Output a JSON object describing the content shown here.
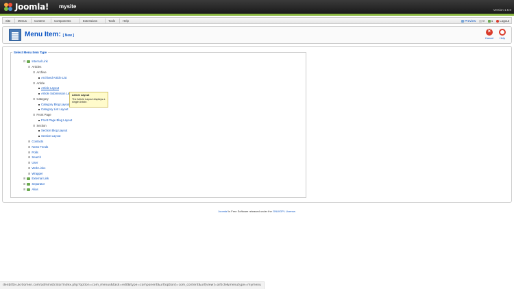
{
  "header": {
    "brand": "Joomla!",
    "site_name": "mysite",
    "version": "Version 1.5.0"
  },
  "menubar": {
    "items": [
      "Site",
      "Menus",
      "Content",
      "Components",
      "Extensions",
      "Tools",
      "Help"
    ],
    "status": {
      "preview": "Preview",
      "messages": "0",
      "users": "1",
      "logout": "Logout"
    }
  },
  "toolbar": {
    "title": "Menu Item:",
    "title_suffix": "[ New ]",
    "cancel": "Cancel",
    "help": "Help"
  },
  "menu_type": {
    "legend": "Select Menu Item Type",
    "tree": {
      "internal_link": "Internal Link",
      "articles": "Articles",
      "archive": "Archive",
      "archived_list": "Archived Article List",
      "article": "Article",
      "article_layout": "Article Layout",
      "article_submission": "Article Submission Layout",
      "category": "Category",
      "category_blog": "Category Blog Layout",
      "category_list": "Category List Layout",
      "front_page": "Front Page",
      "front_page_blog": "Front Page Blog Layout",
      "section": "Section",
      "section_blog": "Section Blog Layout",
      "section_layout": "Section Layout",
      "contacts": "Contacts",
      "news_feeds": "News Feeds",
      "polls": "Polls",
      "search": "Search",
      "user": "User",
      "web_links": "Web Links",
      "wrapper": "Wrapper",
      "external_link": "External Link",
      "separator": "Separator",
      "alias": "Alias"
    }
  },
  "tooltip": {
    "title": "Article Layout",
    "body": "The Article Layout displays a single Article."
  },
  "footer": {
    "link": "Joomla!",
    "text": " is Free Software released under the ",
    "license": "GNU/GPL License."
  },
  "status_url": "denbitte.ukrdomen.com/administrator/index.php?option=com_menus&task=edit&type=component&url[option]=com_content&url[view]=article&menutype=mymenu"
}
